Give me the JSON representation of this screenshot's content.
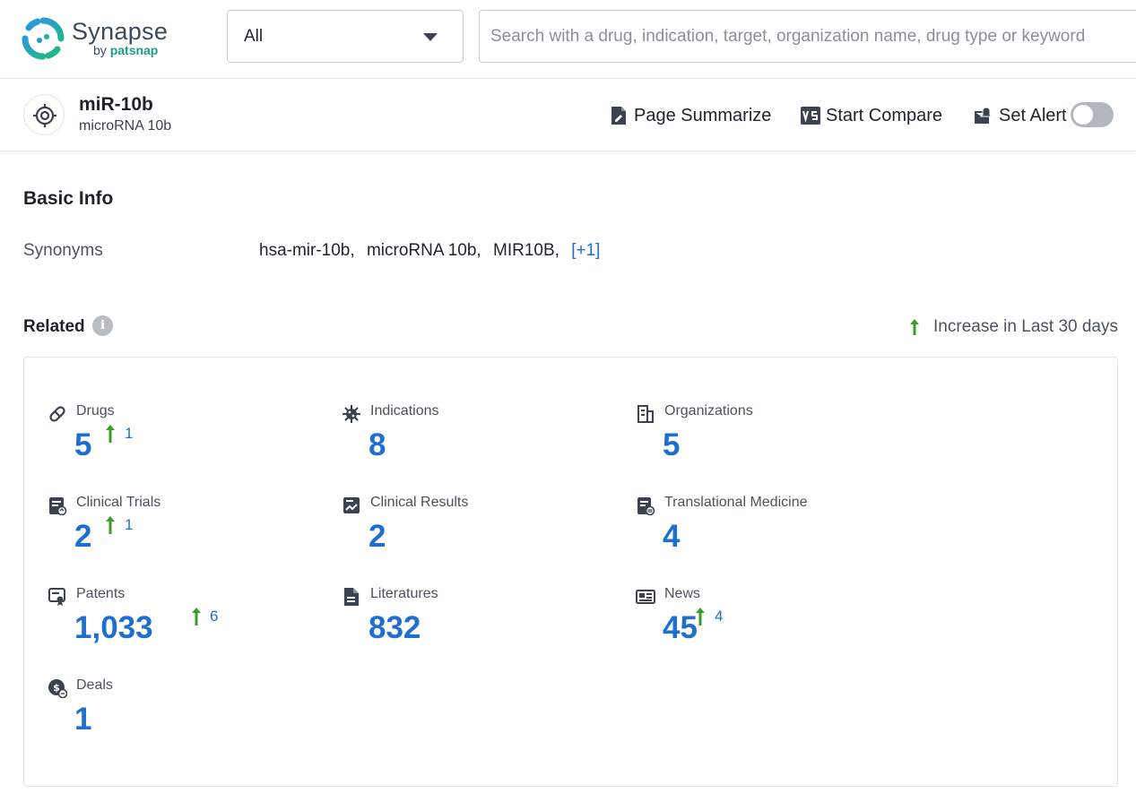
{
  "app": {
    "logo_name": "Synapse",
    "logo_by": "by",
    "logo_brand": "patsnap",
    "icon": "synapse-logo-icon"
  },
  "search": {
    "scope_value": "All",
    "placeholder": "Search with a drug, indication, target, organization name, drug type or keyword",
    "value": ""
  },
  "entity": {
    "title": "miR-10b",
    "subtitle": "microRNA 10b",
    "icon": "target-icon"
  },
  "actions": {
    "summarize": "Page Summarize",
    "compare": "Start Compare",
    "alert": "Set Alert",
    "alert_enabled": false
  },
  "basic_info": {
    "heading": "Basic Info",
    "synonyms_label": "Synonyms",
    "synonyms": [
      "hsa-mir-10b,",
      "microRNA 10b,",
      "MIR10B,"
    ],
    "synonyms_more": "[+1]"
  },
  "related": {
    "heading": "Related",
    "legend": "Increase in Last 30 days",
    "colors": {
      "accent": "#1f6fd0",
      "increase": "#3a9c2a"
    },
    "stats": [
      {
        "label": "Drugs",
        "value": "5",
        "increase": "1",
        "icon": "pill-icon"
      },
      {
        "label": "Indications",
        "value": "8",
        "increase": "",
        "icon": "virus-icon"
      },
      {
        "label": "Organizations",
        "value": "5",
        "increase": "",
        "icon": "building-icon"
      },
      {
        "label": "Clinical Trials",
        "value": "2",
        "increase": "1",
        "icon": "clipboard-icon"
      },
      {
        "label": "Clinical Results",
        "value": "2",
        "increase": "",
        "icon": "chart-report-icon"
      },
      {
        "label": "Translational Medicine",
        "value": "4",
        "increase": "",
        "icon": "translational-doc-icon"
      },
      {
        "label": "Patents",
        "value": "1,033",
        "increase": "6",
        "icon": "patent-icon"
      },
      {
        "label": "Literatures",
        "value": "832",
        "increase": "",
        "icon": "document-icon"
      },
      {
        "label": "News",
        "value": "45",
        "increase": "4",
        "icon": "newspaper-icon"
      },
      {
        "label": "Deals",
        "value": "1",
        "increase": "",
        "icon": "deal-icon"
      }
    ]
  }
}
